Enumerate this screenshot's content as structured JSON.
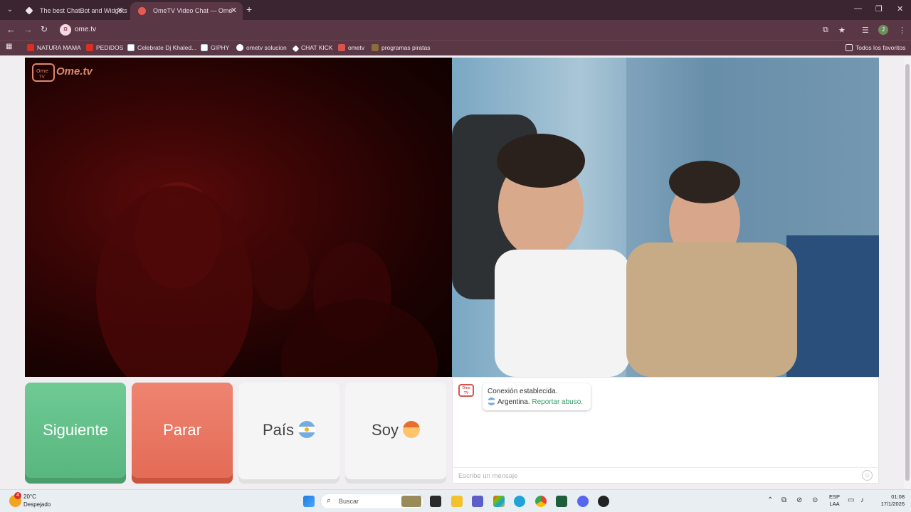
{
  "browser": {
    "tabs": [
      {
        "title": "The best ChatBot and Widgets",
        "favicon": "diamond-icon",
        "active": false
      },
      {
        "title": "OmeTV Video Chat — Ome",
        "favicon": "ometv-icon",
        "active": true
      }
    ],
    "url": "ome.tv",
    "bookmarks": [
      {
        "label": "NATURA MAMA",
        "icon": "red-square",
        "color": "#d93025"
      },
      {
        "label": "PEDIDOS",
        "icon": "red-square",
        "color": "#d93025"
      },
      {
        "label": "Celebrate Dj Khaled...",
        "icon": "doc-icon",
        "color": "#ffffff"
      },
      {
        "label": "GIPHY",
        "icon": "doc-icon",
        "color": "#ffffff"
      },
      {
        "label": "ometv solucion",
        "icon": "google-icon",
        "color": "#ffffff"
      },
      {
        "label": "CHAT KICK",
        "icon": "diamond-icon",
        "color": "#ffffff"
      },
      {
        "label": "ometv",
        "icon": "ome-icon",
        "color": "#d9534f"
      },
      {
        "label": "programas piratas",
        "icon": "ap-icon",
        "color": "#8b6c3c"
      }
    ],
    "all_bookmarks": "Todos los favoritos"
  },
  "app": {
    "logo_text": "Ome.tv",
    "buttons": {
      "next": "Siguiente",
      "stop": "Parar",
      "country": "País",
      "gender": "Soy"
    },
    "chat": {
      "status": "Conexión establecida.",
      "country": "Argentina.",
      "report": "Reportar abuso.",
      "placeholder": "Escribe un mensaje"
    }
  },
  "taskbar": {
    "weather_badge": "4",
    "temperature": "20°C",
    "weather_desc": "Despejado",
    "search": "Buscar",
    "lang_top": "ESP",
    "lang_bottom": "LAA",
    "time": "01:08",
    "date": "17/1/2026"
  }
}
